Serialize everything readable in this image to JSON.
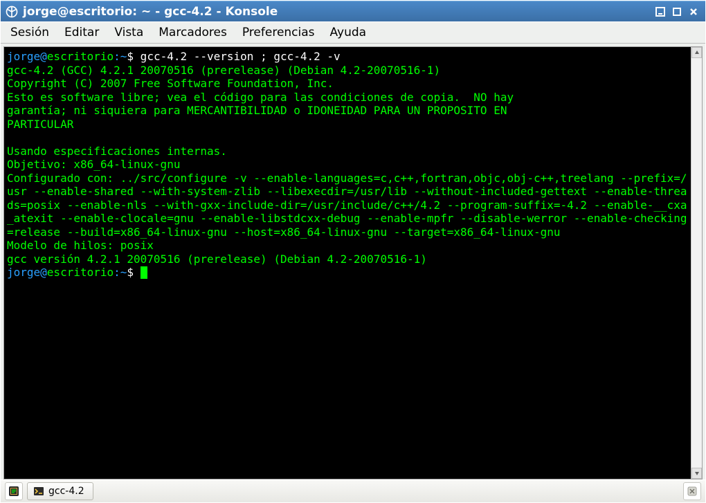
{
  "titlebar": {
    "title": "jorge@escritorio: ~ - gcc-4.2 - Konsole"
  },
  "menu": {
    "session": "Sesión",
    "edit": "Editar",
    "view": "Vista",
    "bookmarks": "Marcadores",
    "preferences": "Preferencias",
    "help": "Ayuda"
  },
  "terminal": {
    "prompt1": {
      "user": "jorge@",
      "host": "escritorio",
      "colon": ":",
      "path": "~",
      "dollar": "$",
      "command": " gcc-4.2 --version ; gcc-4.2 -v"
    },
    "body": "gcc-4.2 (GCC) 4.2.1 20070516 (prerelease) (Debian 4.2-20070516-1)\nCopyright (C) 2007 Free Software Foundation, Inc.\nEsto es software libre; vea el código para las condiciones de copia.  NO hay\ngarantía; ni siquiera para MERCANTIBILIDAD o IDONEIDAD PARA UN PROPOSITO EN\nPARTICULAR\n\nUsando especificaciones internas.\nObjetivo: x86_64-linux-gnu\nConfigurado con: ../src/configure -v --enable-languages=c,c++,fortran,objc,obj-c++,treelang --prefix=/usr --enable-shared --with-system-zlib --libexecdir=/usr/lib --without-included-gettext --enable-threads=posix --enable-nls --with-gxx-include-dir=/usr/include/c++/4.2 --program-suffix=-4.2 --enable-__cxa_atexit --enable-clocale=gnu --enable-libstdcxx-debug --enable-mpfr --disable-werror --enable-checking=release --build=x86_64-linux-gnu --host=x86_64-linux-gnu --target=x86_64-linux-gnu\nModelo de hilos: posix\ngcc versión 4.2.1 20070516 (prerelease) (Debian 4.2-20070516-1)",
    "prompt2": {
      "user": "jorge@",
      "host": "escritorio",
      "colon": ":",
      "path": "~",
      "dollar": "$"
    }
  },
  "taskbar": {
    "tab_label": "gcc-4.2"
  }
}
